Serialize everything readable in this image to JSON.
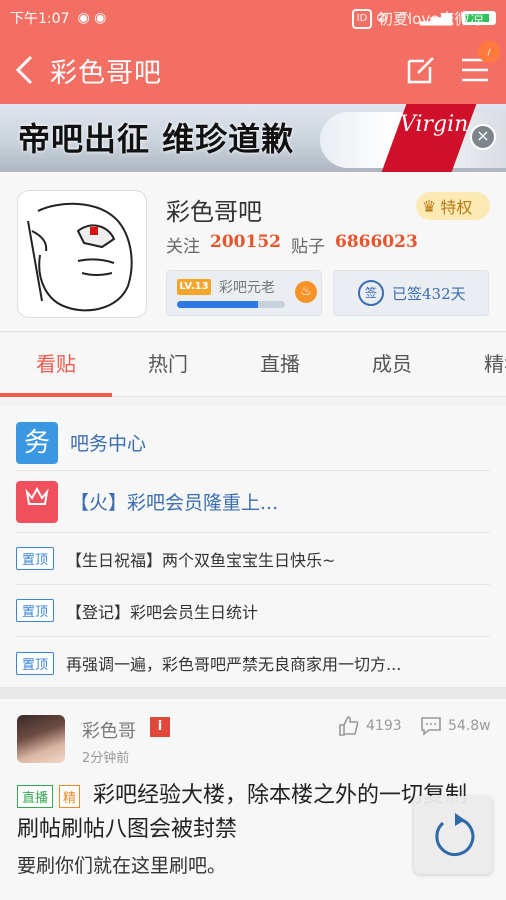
{
  "status_bar": {
    "time": "下午1:07",
    "carrier_text": "初夏love恋微凉",
    "battery": "69"
  },
  "nav": {
    "title": "彩色哥吧",
    "notification_count": "/"
  },
  "banner": {
    "headline": "帝吧出征  维珍道歉",
    "brand": "Virgin",
    "close_symbol": "×"
  },
  "forum": {
    "name": "彩色哥吧",
    "privilege_label": "特权",
    "follow_label": "关注",
    "follow_count": "200152",
    "posts_label": "贴子",
    "posts_count": "6866023",
    "level_tag": "LV.13",
    "level_title": "彩吧元老",
    "level_progress": 0.75,
    "signed_text": "已签432天",
    "sign_icon_text": "签"
  },
  "tabs": [
    {
      "label": "看贴",
      "active": true
    },
    {
      "label": "热门",
      "active": false
    },
    {
      "label": "直播",
      "active": false
    },
    {
      "label": "成员",
      "active": false
    },
    {
      "label": "精华",
      "active": false
    }
  ],
  "notices": {
    "service": {
      "icon_text": "务",
      "title": "吧务中心",
      "color": "#3a97e1"
    },
    "member": {
      "title": "【火】彩吧会员隆重上...",
      "color": "#f0505e"
    },
    "pinned": [
      {
        "tag": "置顶",
        "text": "【生日祝福】两个双鱼宝宝生日快乐~"
      },
      {
        "tag": "置顶",
        "text": "【登记】彩吧会员生日统计"
      },
      {
        "tag": "置顶",
        "text": "再强调一遍，彩色哥吧严禁无良商家用一切方..."
      }
    ]
  },
  "post": {
    "author": "彩色哥",
    "info_badge": "i",
    "time": "2分钟前",
    "likes": "4193",
    "comments": "54.8w",
    "tag_live": "直播",
    "tag_best": "精",
    "title": "彩吧经验大楼，除本楼之外的一切复制刷帖刷帖八图会被封禁",
    "body": "要刷你们就在这里刷吧。"
  },
  "colors": {
    "header": "#f46f63",
    "accent": "#f05b4e",
    "link": "#3b6db0"
  }
}
